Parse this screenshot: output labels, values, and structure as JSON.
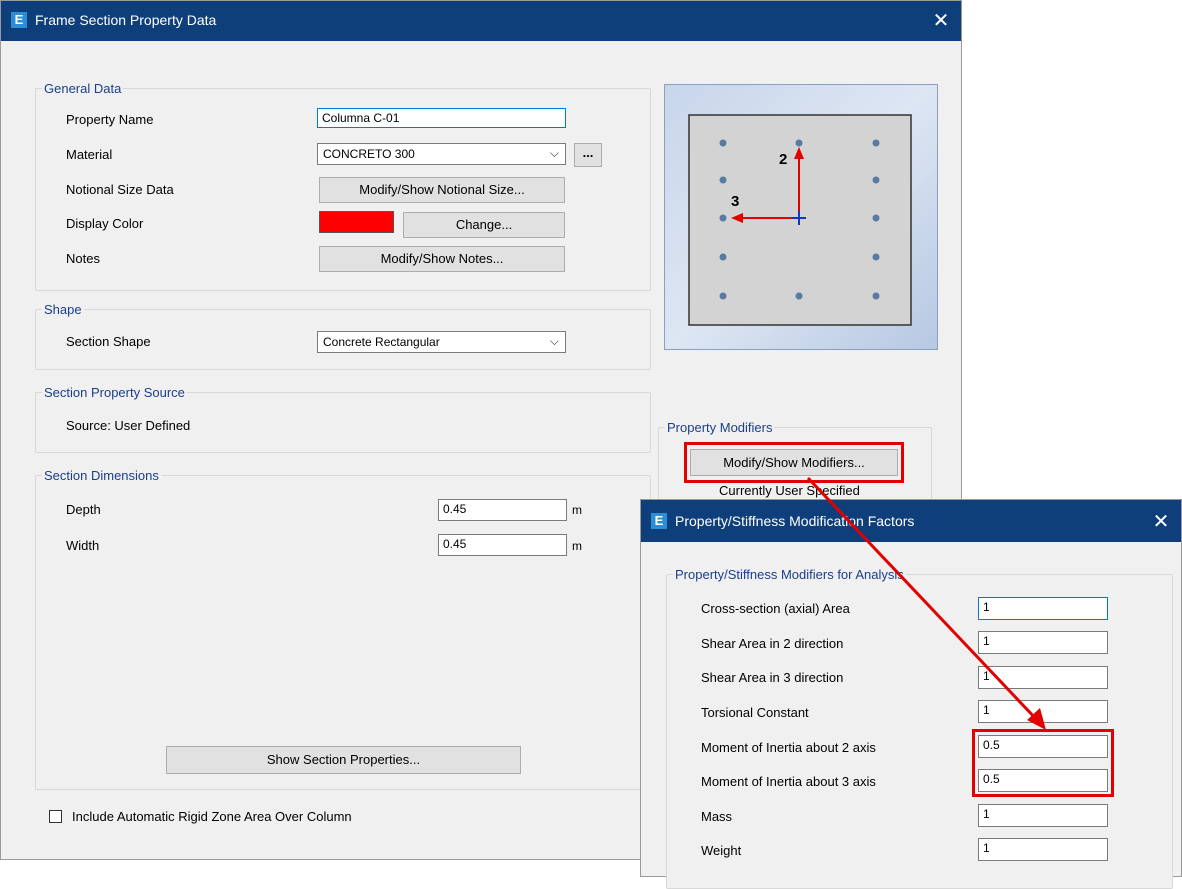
{
  "main_dialog": {
    "title": "Frame Section Property Data",
    "general_data": {
      "legend": "General Data",
      "property_name_label": "Property Name",
      "property_name_value": "Columna C-01",
      "material_label": "Material",
      "material_value": "CONCRETO 300",
      "ellipsis_label": "...",
      "notional_size_label": "Notional Size Data",
      "notional_size_button": "Modify/Show Notional Size...",
      "display_color_label": "Display Color",
      "display_color": "#ff0000",
      "change_button": "Change...",
      "notes_label": "Notes",
      "notes_button": "Modify/Show Notes..."
    },
    "shape": {
      "legend": "Shape",
      "section_shape_label": "Section Shape",
      "section_shape_value": "Concrete Rectangular"
    },
    "source": {
      "legend": "Section Property Source",
      "text": "Source:  User Defined"
    },
    "dimensions": {
      "legend": "Section Dimensions",
      "depth_label": "Depth",
      "depth_value": "0.45",
      "depth_unit": "m",
      "width_label": "Width",
      "width_value": "0.45",
      "width_unit": "m",
      "show_properties_button": "Show Section Properties..."
    },
    "rigid_zone_label": "Include Automatic Rigid Zone Area Over Column",
    "preview": {
      "axis_2_label": "2",
      "axis_3_label": "3"
    },
    "property_modifiers": {
      "legend": "Property Modifiers",
      "button": "Modify/Show Modifiers...",
      "status": "Currently User Specified"
    }
  },
  "modifiers_dialog": {
    "title": "Property/Stiffness Modification Factors",
    "legend": "Property/Stiffness Modifiers for Analysis",
    "rows": [
      {
        "label": "Cross-section (axial) Area",
        "value": "1"
      },
      {
        "label": "Shear Area in 2 direction",
        "value": "1"
      },
      {
        "label": "Shear Area in 3 direction",
        "value": "1"
      },
      {
        "label": "Torsional Constant",
        "value": "1"
      },
      {
        "label": "Moment of Inertia about 2 axis",
        "value": "0.5"
      },
      {
        "label": "Moment of Inertia about 3 axis",
        "value": "0.5"
      },
      {
        "label": "Mass",
        "value": "1"
      },
      {
        "label": "Weight",
        "value": "1"
      }
    ]
  },
  "colors": {
    "titlebar": "#0f3f7a",
    "highlight": "#e20000",
    "accent": "#1a3e8c"
  }
}
